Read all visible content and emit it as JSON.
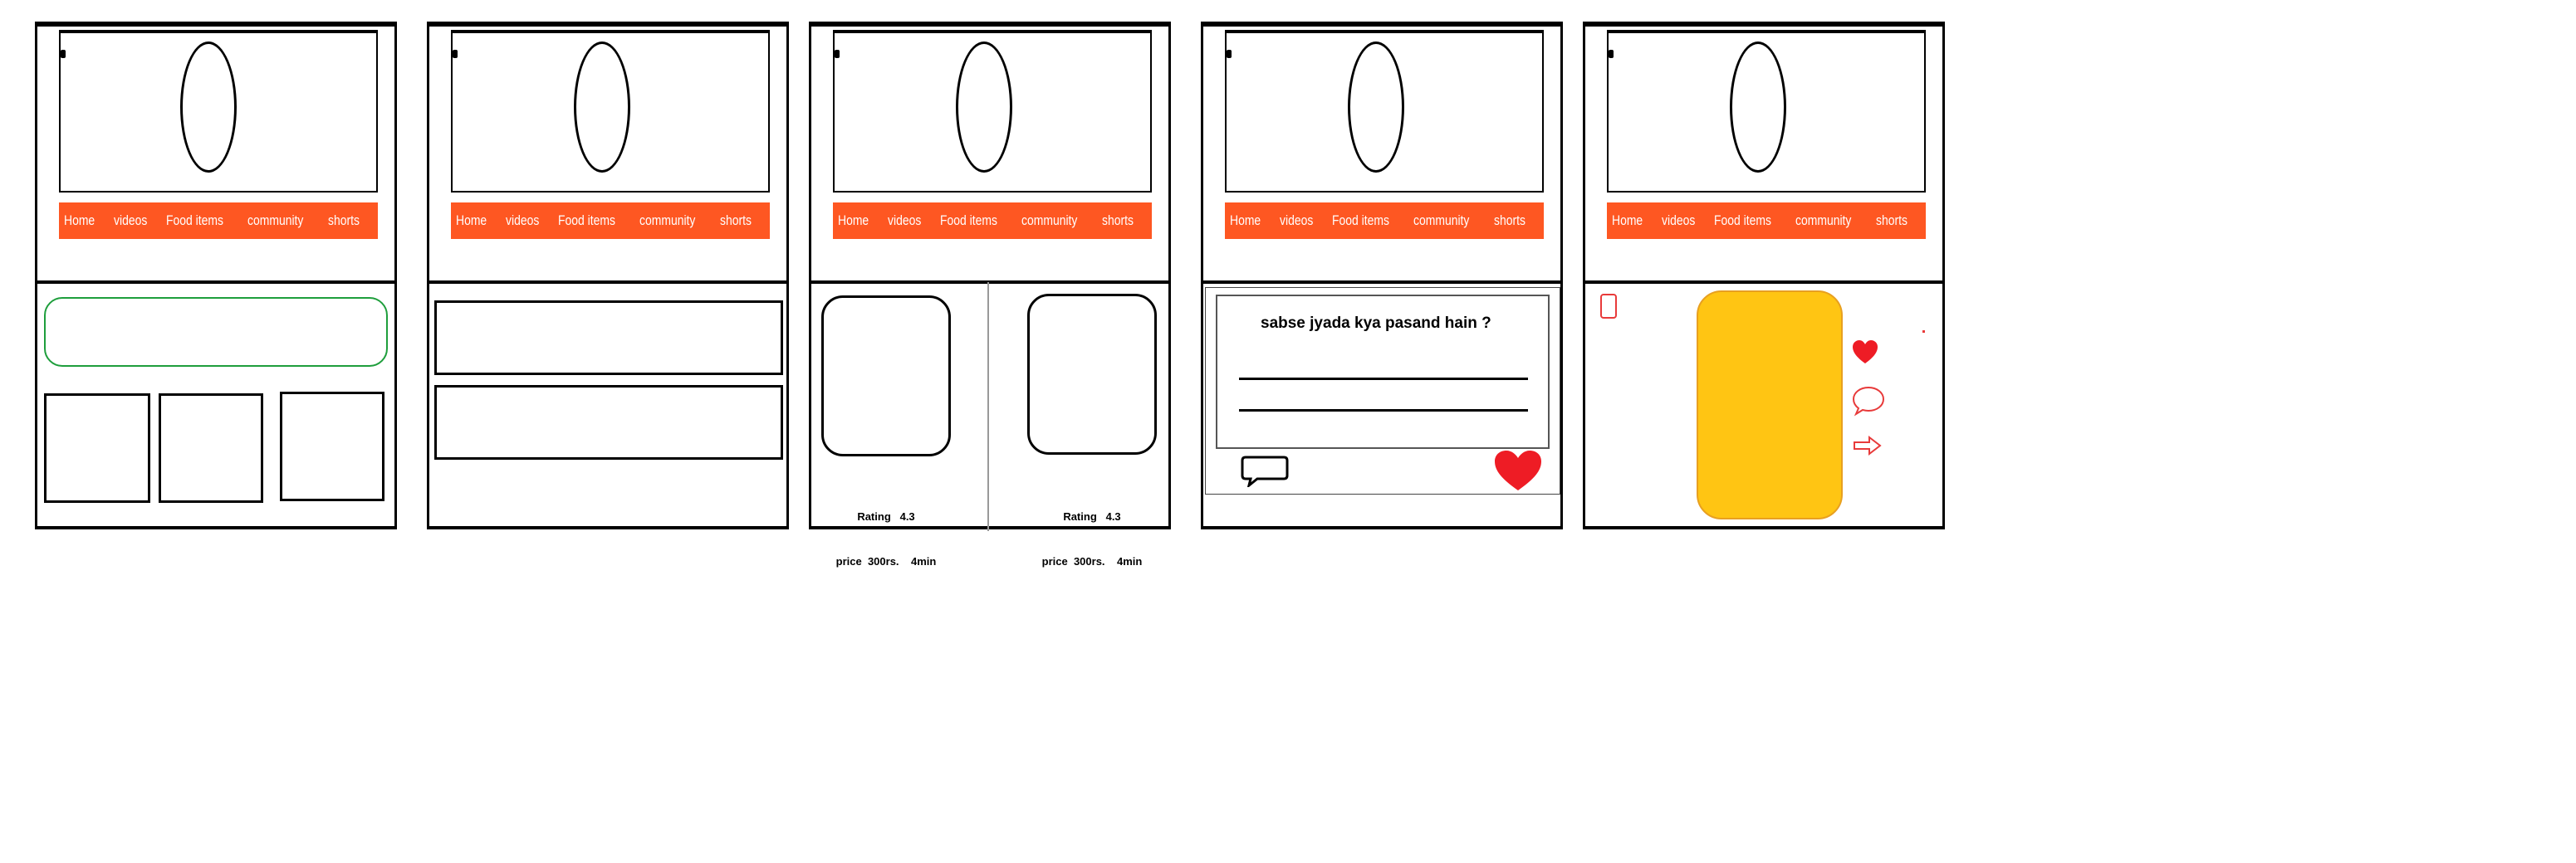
{
  "nav": {
    "items": [
      "Home",
      "videos",
      "Food items",
      "community",
      "shorts"
    ]
  },
  "cards": [
    {
      "rating": "Rating   4.3",
      "price": "price  300rs.    4min"
    },
    {
      "rating": "Rating   4.3",
      "price": "price  300rs.    4min"
    }
  ],
  "poll": {
    "question": "sabse jyada kya pasand hain ?"
  },
  "colors": {
    "nav": "#fe5722",
    "green_outline": "#1e9e3c",
    "heart": "#ee1c25",
    "short_video": "#ffc513",
    "icon_outline": "#e83a3a"
  },
  "icons": [
    "heart-icon",
    "comment-icon",
    "share-arrow-icon"
  ]
}
